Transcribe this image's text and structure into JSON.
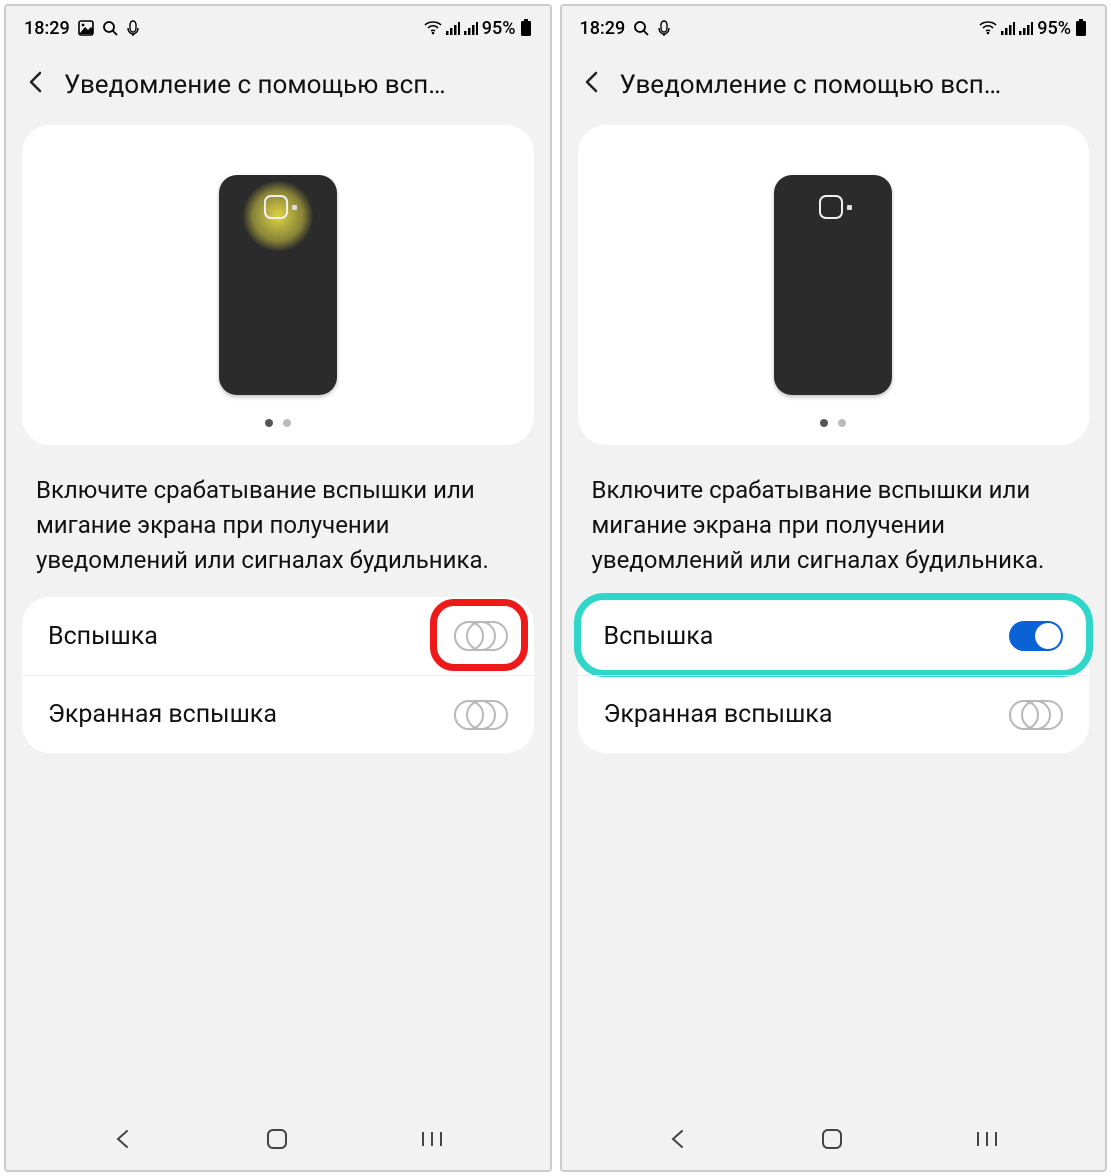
{
  "status": {
    "time": "18:29",
    "battery_pct": "95%"
  },
  "header": {
    "title": "Уведомление с помощью всп…"
  },
  "description": "Включите срабатывание вспышки или мигание экрана при получении уведомлений или сигналах будильника.",
  "rows": {
    "flash": "Вспышка",
    "screen_flash": "Экранная вспышка"
  },
  "screens": [
    {
      "flash_on": false,
      "flash_glow": true,
      "highlight": "red-toggle",
      "status_icons": [
        "gallery",
        "search",
        "voice"
      ]
    },
    {
      "flash_on": true,
      "flash_glow": false,
      "highlight": "teal-row",
      "status_icons": [
        "search",
        "voice"
      ]
    }
  ]
}
